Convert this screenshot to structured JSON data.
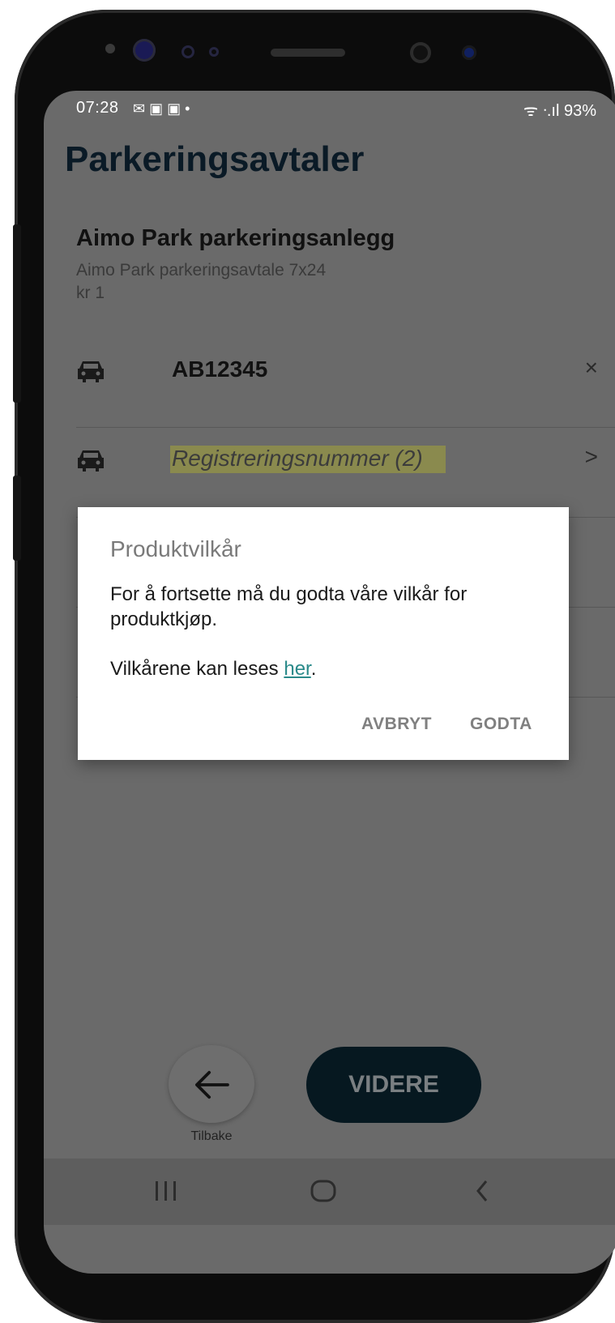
{
  "status": {
    "time": "07:28",
    "right": "ᯤ ᐧ.ıl 93%"
  },
  "page_title": "Parkeringsavtaler",
  "provider": {
    "name": "Aimo Park parkeringsanlegg",
    "agreement": "Aimo Park parkeringsavtale 7x24",
    "price": "kr 1"
  },
  "vehicles": [
    {
      "plate": "AB12345",
      "action": "×"
    },
    {
      "placeholder": "Registreringsnummer (2)",
      "action": ">"
    }
  ],
  "dialog": {
    "title": "Produktvilkår",
    "body": "For å fortsette må du godta våre vilkår for produktkjøp.",
    "terms_prefix": "Vilkårene kan leses ",
    "terms_link": "her",
    "terms_suffix": ".",
    "cancel": "AVBRYT",
    "accept": "GODTA"
  },
  "footer": {
    "back_label": "Tilbake",
    "next_label": "VIDERE"
  },
  "colors": {
    "title": "#0a1a26",
    "link": "#2a8a8a",
    "primary_button": "#061820",
    "highlight": "#8a8a4e"
  }
}
